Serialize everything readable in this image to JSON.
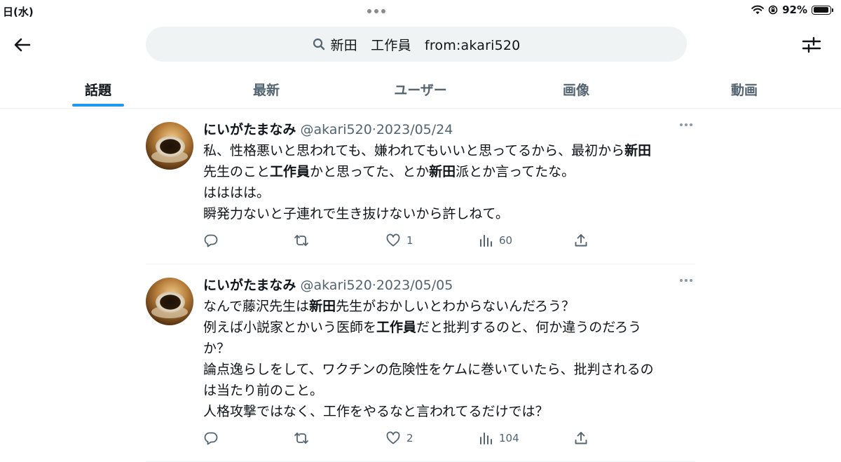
{
  "status_bar": {
    "date": "日(水)",
    "battery": "92%"
  },
  "search": {
    "query": "新田　工作員　from:akari520"
  },
  "tabs": [
    {
      "label": "話題"
    },
    {
      "label": "最新"
    },
    {
      "label": "ユーザー"
    },
    {
      "label": "画像"
    },
    {
      "label": "動画"
    }
  ],
  "tweets": [
    {
      "name": "にいがたまなみ",
      "handle": "@akari520",
      "sep": "·",
      "date": "2023/05/24",
      "lines": [
        [
          {
            "t": "私、性格悪いと思われても、嫌われてもいいと思ってるから、最初から"
          },
          {
            "t": "新田",
            "b": true
          }
        ],
        [
          {
            "t": "先生のこと"
          },
          {
            "t": "工作員",
            "b": true
          },
          {
            "t": "かと思ってた、とか"
          },
          {
            "t": "新田",
            "b": true
          },
          {
            "t": "派とか言ってたな。"
          }
        ],
        [
          {
            "t": "はははは。"
          }
        ],
        [
          {
            "t": "瞬発力ないと子連れで生き抜けないから許しねて。"
          }
        ]
      ],
      "likes": "1",
      "views": "60"
    },
    {
      "name": "にいがたまなみ",
      "handle": "@akari520",
      "sep": "·",
      "date": "2023/05/05",
      "lines": [
        [
          {
            "t": "なんで藤沢先生は"
          },
          {
            "t": "新田",
            "b": true
          },
          {
            "t": "先生がおかしいとわからないんだろう？"
          }
        ],
        [
          {
            "t": "例えば小説家とかいう医師を"
          },
          {
            "t": "工作員",
            "b": true
          },
          {
            "t": "だと批判するのと、何か違うのだろう"
          }
        ],
        [
          {
            "t": "か？"
          }
        ],
        [
          {
            "t": "論点逸らしをして、ワクチンの危険性をケムに巻いていたら、批判されるの"
          }
        ],
        [
          {
            "t": "は当たり前のこと。"
          }
        ],
        [
          {
            "t": "人格攻撃ではなく、工作をやるなと言われてるだけでは？"
          }
        ]
      ],
      "likes": "2",
      "views": "104"
    }
  ]
}
